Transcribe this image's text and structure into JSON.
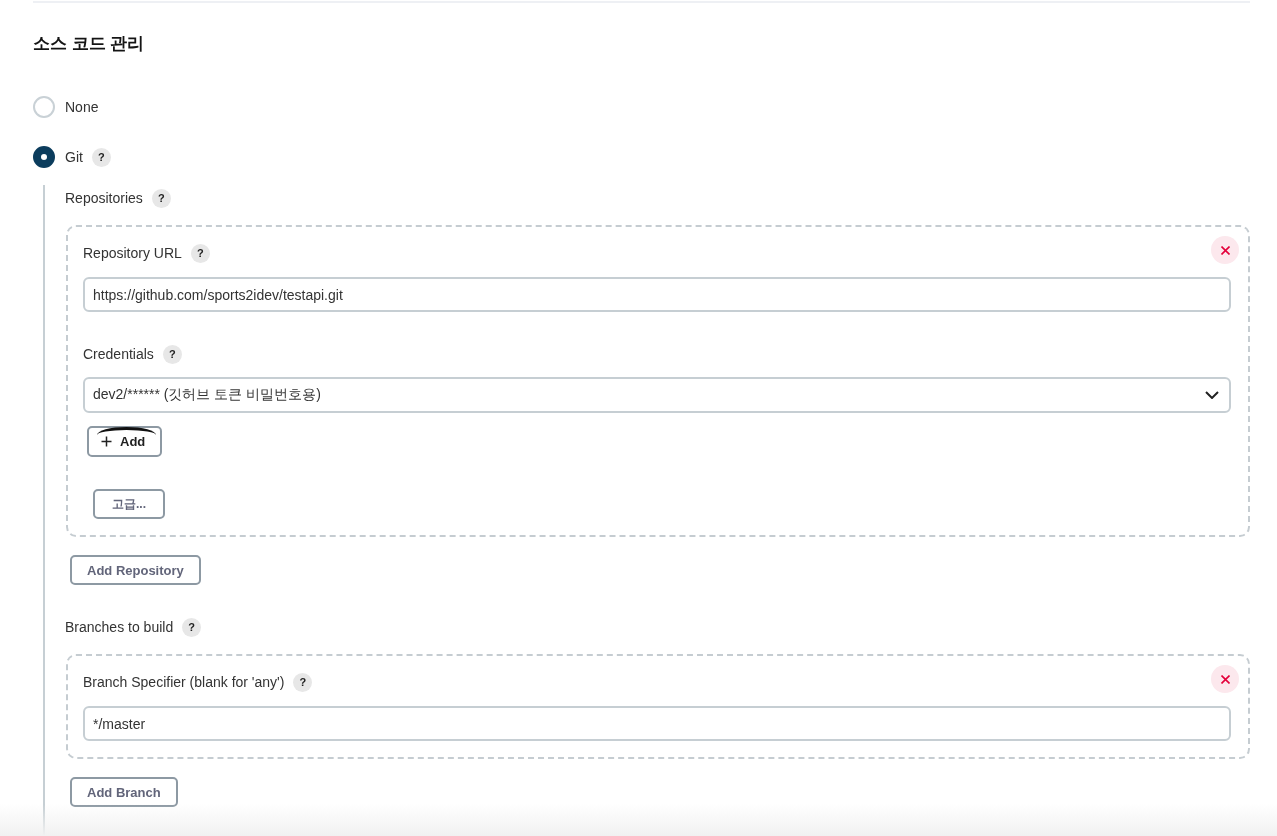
{
  "section": {
    "title": "소스 코드 관리"
  },
  "scm_options": [
    {
      "label": "None",
      "selected": false
    },
    {
      "label": "Git",
      "selected": true,
      "help": "?"
    }
  ],
  "git": {
    "groups": [
      {
        "label": "Repositories",
        "help": "?",
        "items": [
          {
            "fields": [
              {
                "kind": "text",
                "label": "Repository URL",
                "help": "?",
                "value": "https://github.com/sports2idev/testapi.git"
              },
              {
                "kind": "select",
                "label": "Credentials",
                "help": "?",
                "value": "dev2/****** (깃허브 토큰 비밀번호용)",
                "add_button": "Add"
              }
            ],
            "advanced_button": "고급..."
          }
        ],
        "add_button": "Add Repository"
      },
      {
        "label": "Branches to build",
        "help": "?",
        "items": [
          {
            "fields": [
              {
                "kind": "text",
                "label": "Branch Specifier (blank for 'any')",
                "help": "?",
                "value": "*/master"
              }
            ]
          }
        ],
        "add_button": "Add Branch"
      }
    ]
  }
}
